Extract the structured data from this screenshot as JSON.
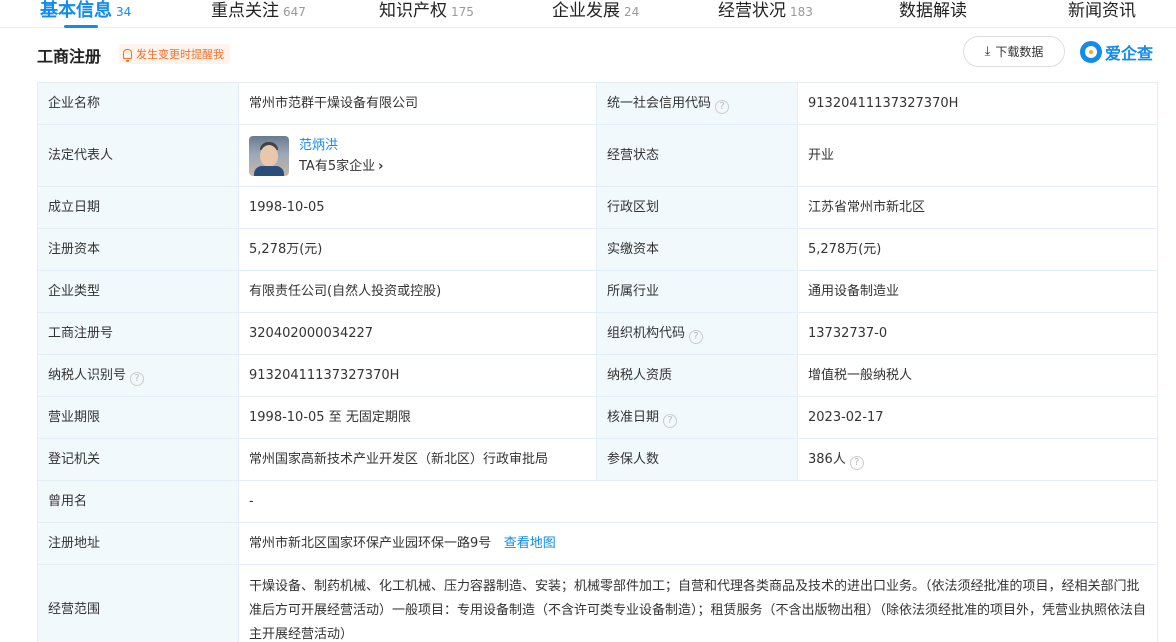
{
  "tabs": [
    {
      "label": "基本信息",
      "count": "34",
      "active": true
    },
    {
      "label": "重点关注",
      "count": "647"
    },
    {
      "label": "知识产权",
      "count": "175"
    },
    {
      "label": "企业发展",
      "count": "24"
    },
    {
      "label": "经营状况",
      "count": "183"
    },
    {
      "label": "数据解读",
      "count": ""
    },
    {
      "label": "新闻资讯",
      "count": ""
    }
  ],
  "section": {
    "title": "工商注册",
    "remind": "发生变更时提醒我",
    "download": "下载数据",
    "logo": "爱企查"
  },
  "fields": {
    "name": {
      "label": "企业名称",
      "value": "常州市范群干燥设备有限公司"
    },
    "uscc": {
      "label": "统一社会信用代码",
      "value": "91320411137327370H"
    },
    "legal_rep": {
      "label": "法定代表人",
      "name": "范炳洪",
      "more": "TA有5家企业"
    },
    "status": {
      "label": "经营状态",
      "value": "开业"
    },
    "founded": {
      "label": "成立日期",
      "value": "1998-10-05"
    },
    "region": {
      "label": "行政区划",
      "value": "江苏省常州市新北区"
    },
    "reg_capital": {
      "label": "注册资本",
      "value": "5,278万(元)"
    },
    "paid_capital": {
      "label": "实缴资本",
      "value": "5,278万(元)"
    },
    "type": {
      "label": "企业类型",
      "value": "有限责任公司(自然人投资或控股)"
    },
    "industry": {
      "label": "所属行业",
      "value": "通用设备制造业"
    },
    "reg_no": {
      "label": "工商注册号",
      "value": "320402000034227"
    },
    "org_code": {
      "label": "组织机构代码",
      "value": "13732737-0"
    },
    "tax_id": {
      "label": "纳税人识别号",
      "value": "91320411137327370H"
    },
    "tax_qual": {
      "label": "纳税人资质",
      "value": "增值税一般纳税人"
    },
    "term": {
      "label": "营业期限",
      "value": "1998-10-05 至 无固定期限"
    },
    "approved": {
      "label": "核准日期",
      "value": "2023-02-17"
    },
    "authority": {
      "label": "登记机关",
      "value": "常州国家高新技术产业开发区（新北区）行政审批局"
    },
    "insured": {
      "label": "参保人数",
      "value": "386人"
    },
    "former_name": {
      "label": "曾用名",
      "value": "-"
    },
    "address": {
      "label": "注册地址",
      "value": "常州市新北区国家环保产业园环保一路9号",
      "map_link": "查看地图"
    },
    "scope": {
      "label": "经营范围",
      "value": "干燥设备、制药机械、化工机械、压力容器制造、安装；机械零部件加工；自营和代理各类商品及技术的进出口业务。（依法须经批准的项目，经相关部门批准后方可开展经营活动）一般项目：专用设备制造（不含许可类专业设备制造）；租赁服务（不含出版物出租）（除依法须经批准的项目外，凭营业执照依法自主开展经营活动）"
    }
  }
}
